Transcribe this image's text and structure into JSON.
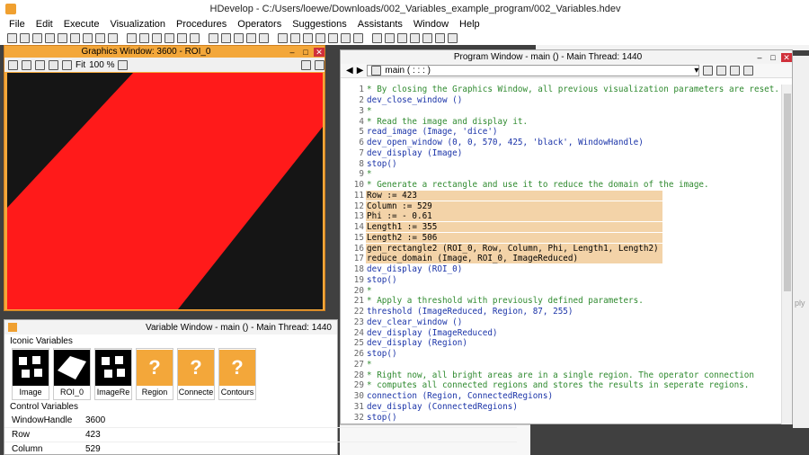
{
  "app": {
    "title": "HDevelop - C:/Users/loewe/Downloads/002_Variables_example_program/002_Variables.hdev"
  },
  "menu": [
    "File",
    "Edit",
    "Execute",
    "Visualization",
    "Procedures",
    "Operators",
    "Suggestions",
    "Assistants",
    "Window",
    "Help"
  ],
  "graphics_window": {
    "title": "Graphics Window: 3600 - ROI_0",
    "fit_label": "Fit",
    "zoom": "100 %",
    "fill_color": "#ff1a1a"
  },
  "program_window": {
    "title": "Program Window - main () - Main Thread: 1440",
    "procedure": "main ( : : : )",
    "lines": [
      {
        "n": "1",
        "text": "* By closing the Graphics Window, all previous visualization parameters are reset.",
        "kind": "comment"
      },
      {
        "n": "2",
        "text": "dev_close_window ()",
        "kind": "op"
      },
      {
        "n": "3",
        "text": "*",
        "kind": "comment"
      },
      {
        "n": "4",
        "text": "* Read the image and display it.",
        "kind": "comment"
      },
      {
        "n": "5",
        "text": "read_image (Image, 'dice')",
        "kind": "op"
      },
      {
        "n": "6",
        "text": "dev_open_window (0, 0, 570, 425, 'black', WindowHandle)",
        "kind": "op"
      },
      {
        "n": "7",
        "text": "dev_display (Image)",
        "kind": "op"
      },
      {
        "n": "8",
        "text": "stop()",
        "kind": "op"
      },
      {
        "n": "9",
        "text": "*",
        "kind": "comment"
      },
      {
        "n": "10",
        "text": "* Generate a rectangle and use it to reduce the domain of the image.",
        "kind": "comment"
      },
      {
        "n": "11",
        "text": "Row := 423",
        "kind": "hl"
      },
      {
        "n": "12",
        "text": "Column := 529",
        "kind": "hl"
      },
      {
        "n": "13",
        "text": "Phi := - 0.61",
        "kind": "hl"
      },
      {
        "n": "14",
        "text": "Length1 := 355",
        "kind": "hl"
      },
      {
        "n": "15",
        "text": "Length2 := 506",
        "kind": "hl"
      },
      {
        "n": "16",
        "text": "gen_rectangle2 (ROI_0, Row, Column, Phi, Length1, Length2)",
        "kind": "hl"
      },
      {
        "n": "17",
        "text": "reduce_domain (Image, ROI_0, ImageReduced)",
        "kind": "hl"
      },
      {
        "n": "18",
        "text": "dev_display (ROI_0)",
        "kind": "op"
      },
      {
        "n": "19",
        "text": "stop()",
        "kind": "op"
      },
      {
        "n": "20",
        "text": "*",
        "kind": "comment"
      },
      {
        "n": "21",
        "text": "* Apply a threshold with previously defined parameters.",
        "kind": "comment"
      },
      {
        "n": "22",
        "text": "threshold (ImageReduced, Region, 87, 255)",
        "kind": "op"
      },
      {
        "n": "23",
        "text": "dev_clear_window ()",
        "kind": "op"
      },
      {
        "n": "24",
        "text": "dev_display (ImageReduced)",
        "kind": "op"
      },
      {
        "n": "25",
        "text": "dev_display (Region)",
        "kind": "op"
      },
      {
        "n": "26",
        "text": "stop()",
        "kind": "op"
      },
      {
        "n": "27",
        "text": "*",
        "kind": "comment"
      },
      {
        "n": "28",
        "text": "* Right now, all bright areas are in a single region. The operator connection",
        "kind": "comment"
      },
      {
        "n": "29",
        "text": "* computes all connected regions and stores the results in seperate regions.",
        "kind": "comment"
      },
      {
        "n": "30",
        "text": "connection (Region, ConnectedRegions)",
        "kind": "op"
      },
      {
        "n": "31",
        "text": "dev_display (ConnectedRegions)",
        "kind": "op"
      },
      {
        "n": "32",
        "text": "stop()",
        "kind": "op"
      }
    ]
  },
  "variable_window": {
    "title": "Variable Window - main () - Main Thread: 1440",
    "iconic_label": "Iconic Variables",
    "control_label": "Control Variables",
    "iconic": [
      {
        "name": "Image",
        "kind": "dice"
      },
      {
        "name": "ROI_0",
        "kind": "roi"
      },
      {
        "name": "ImageRe",
        "kind": "dice"
      },
      {
        "name": "Region",
        "kind": "q"
      },
      {
        "name": "Connecte",
        "kind": "q"
      },
      {
        "name": "Contours",
        "kind": "q"
      }
    ],
    "control": [
      {
        "name": "WindowHandle",
        "value": "3600"
      },
      {
        "name": "Row",
        "value": "423"
      },
      {
        "name": "Column",
        "value": "529"
      }
    ]
  },
  "side": {
    "partial": "ply"
  }
}
